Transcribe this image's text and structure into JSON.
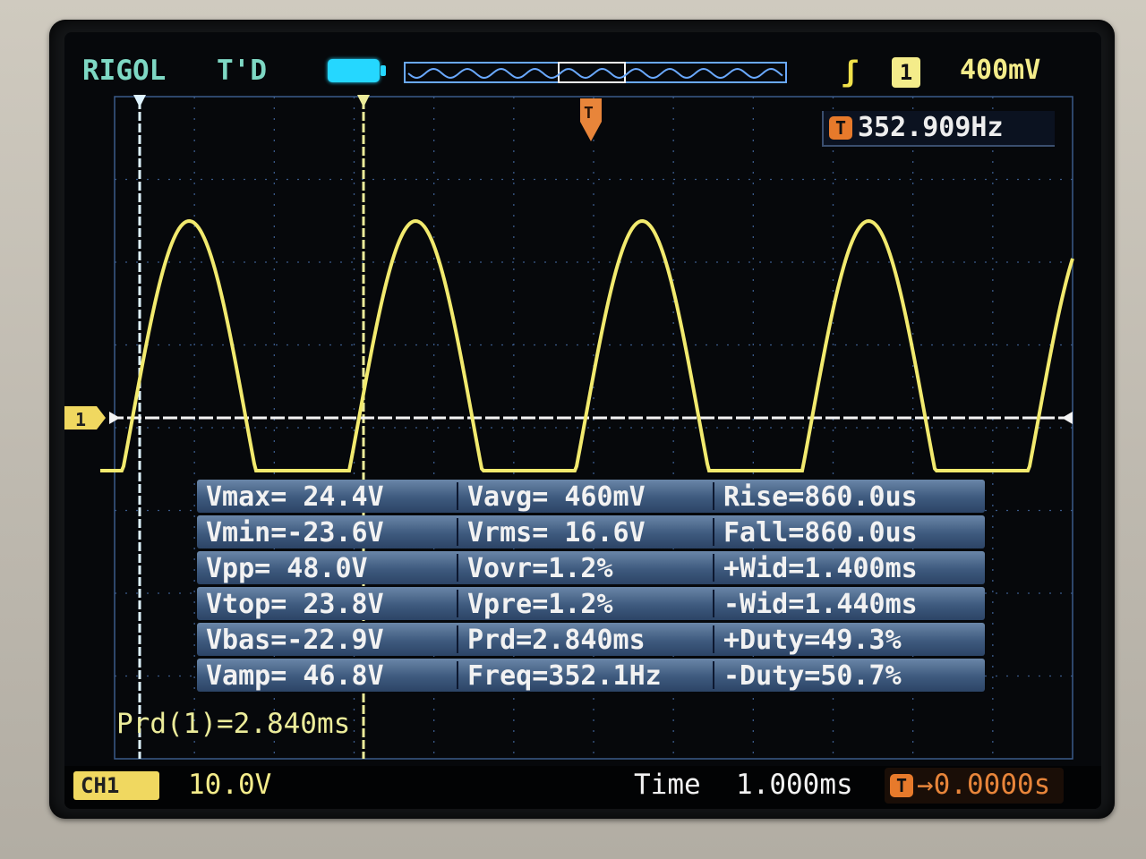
{
  "header": {
    "brand": "RIGOL",
    "trigger_status": "T'D",
    "trigger_slope_symbol": "ʃ",
    "trigger_channel": "1",
    "trigger_level": "400mV"
  },
  "frequency_readout": {
    "icon": "T",
    "value": "352.909Hz"
  },
  "channel_marker": "1",
  "measurements": [
    [
      "Vmax= 24.4V",
      "Vavg= 460mV",
      "Rise=860.0us"
    ],
    [
      "Vmin=-23.6V",
      "Vrms= 16.6V",
      "Fall=860.0us"
    ],
    [
      "Vpp= 48.0V",
      "Vovr=1.2%",
      "+Wid=1.400ms"
    ],
    [
      "Vtop= 23.8V",
      "Vpre=1.2%",
      "-Wid=1.440ms"
    ],
    [
      "Vbas=-22.9V",
      "Prd=2.840ms",
      "+Duty=49.3%"
    ],
    [
      "Vamp= 46.8V",
      "Freq=352.1Hz",
      "-Duty=50.7%"
    ]
  ],
  "cursor_readout": "Prd(1)=2.840ms",
  "footer": {
    "channel_tag": "CH1",
    "channel_scale": "10.0V",
    "time_label": "Time",
    "time_scale": "1.000ms",
    "trigger_offset_icon": "T",
    "trigger_offset": "→0.0000s"
  },
  "colors": {
    "trace": "#f2ea6e",
    "grid": "#3a5a8a",
    "menu": "#3e5a7e",
    "accent_cyan": "#7ed8c4",
    "trigger_orange": "#e77a2b"
  }
}
